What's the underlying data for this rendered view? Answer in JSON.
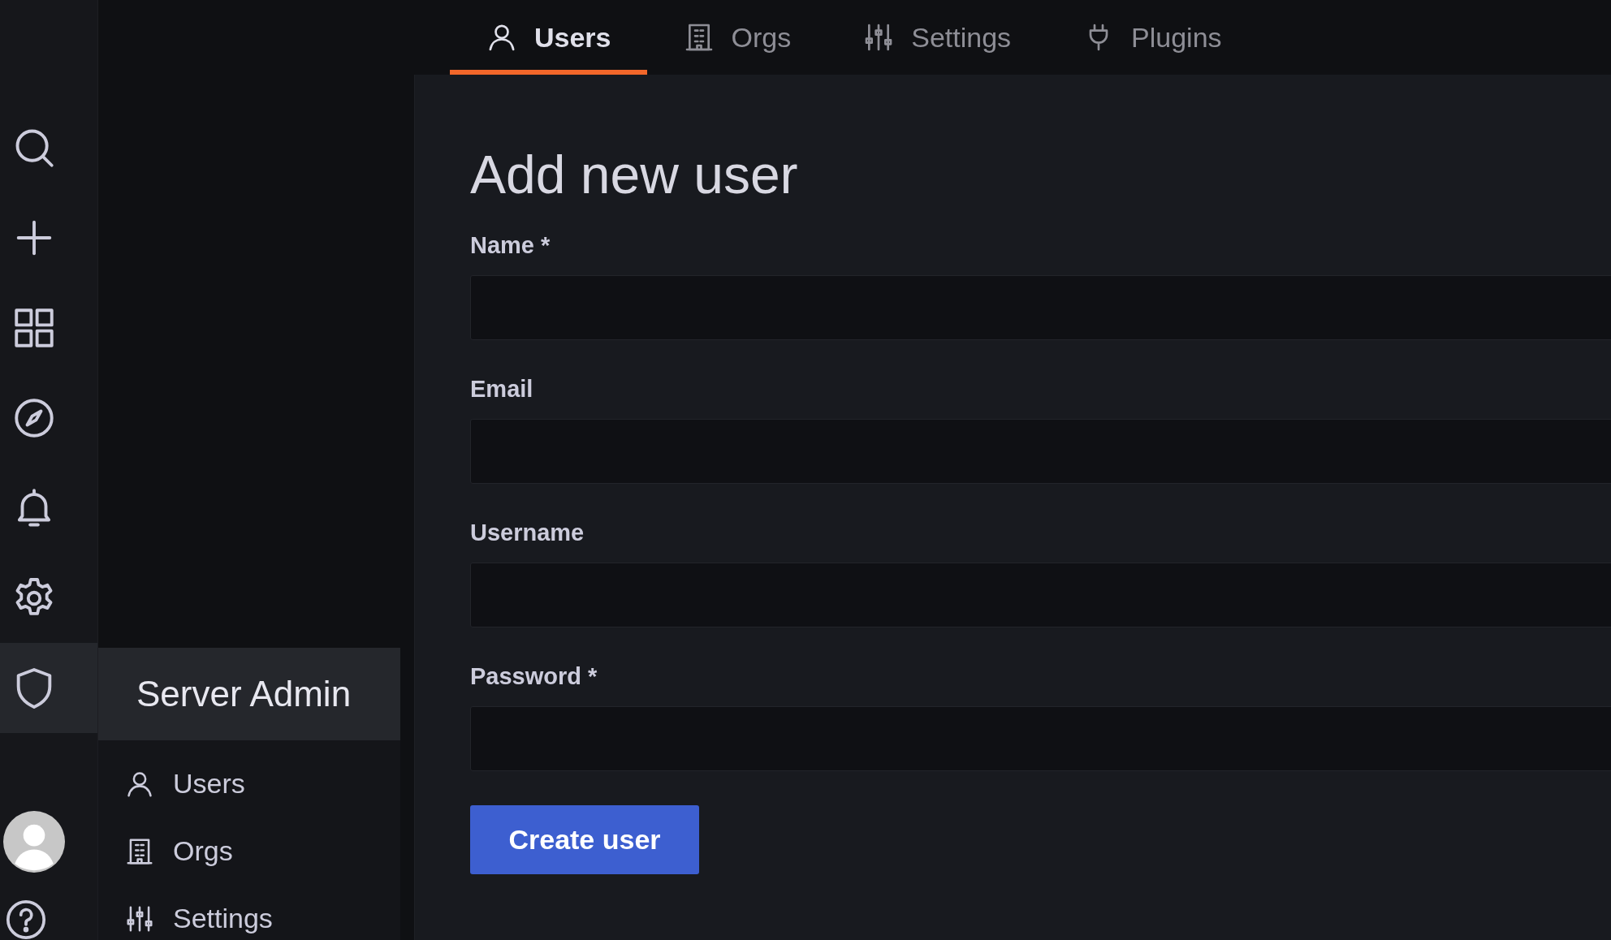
{
  "rail": {
    "items": [
      {
        "kind": "search",
        "selected": false
      },
      {
        "kind": "plus",
        "selected": false
      },
      {
        "kind": "grid",
        "selected": false
      },
      {
        "kind": "compass",
        "selected": false
      },
      {
        "kind": "bell",
        "selected": false
      },
      {
        "kind": "gear",
        "selected": false
      },
      {
        "kind": "shield",
        "selected": true
      }
    ],
    "bottom": [
      {
        "kind": "avatar"
      },
      {
        "kind": "help"
      }
    ]
  },
  "flyout": {
    "title": "Server Admin",
    "items": [
      {
        "label": "Users",
        "kind": "user"
      },
      {
        "label": "Orgs",
        "kind": "building"
      },
      {
        "label": "Settings",
        "kind": "sliders"
      }
    ]
  },
  "tabs": [
    {
      "label": "Users",
      "kind": "user",
      "selected": true
    },
    {
      "label": "Orgs",
      "kind": "building",
      "selected": false
    },
    {
      "label": "Settings",
      "kind": "sliders",
      "selected": false
    },
    {
      "label": "Plugins",
      "kind": "plug",
      "selected": false
    }
  ],
  "form": {
    "title": "Add new user",
    "fields": [
      {
        "label": "Name *"
      },
      {
        "label": "Email"
      },
      {
        "label": "Username"
      },
      {
        "label": "Password *"
      }
    ],
    "submit": "Create user"
  }
}
